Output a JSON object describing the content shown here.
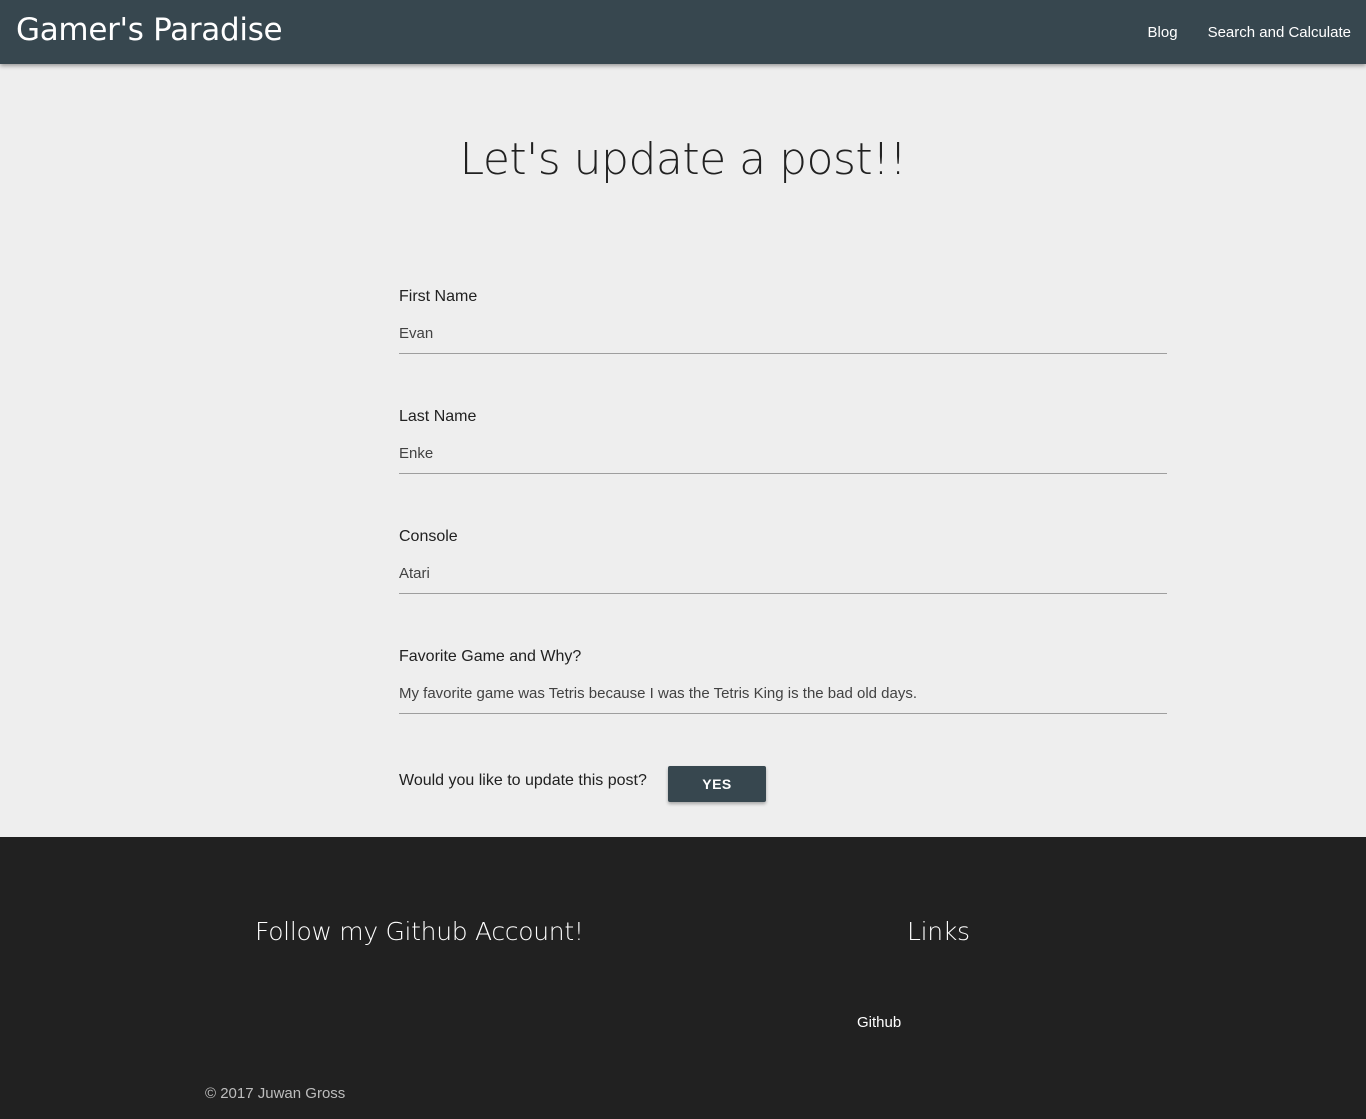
{
  "navbar": {
    "brand": "Gamer's Paradise",
    "links": [
      {
        "label": "Blog"
      },
      {
        "label": "Search and Calculate"
      }
    ]
  },
  "main": {
    "title": "Let's update a post!!",
    "fields": [
      {
        "label": "First Name",
        "value": "Evan"
      },
      {
        "label": "Last Name",
        "value": "Enke"
      },
      {
        "label": "Console",
        "value": "Atari"
      },
      {
        "label": "Favorite Game and Why?",
        "value": "My favorite game was Tetris because I was the Tetris King is the bad old days."
      }
    ],
    "question": "Would you like to update this post?",
    "confirm_label": "YES"
  },
  "footer": {
    "follow_heading": "Follow my Github Account!",
    "links_heading": "Links",
    "github_link": "Github",
    "copyright": "© 2017 Juwan Gross"
  },
  "colors": {
    "navbar": "#37474f",
    "page_background": "#eeeeee",
    "footer": "#212121",
    "button": "#37474f"
  }
}
